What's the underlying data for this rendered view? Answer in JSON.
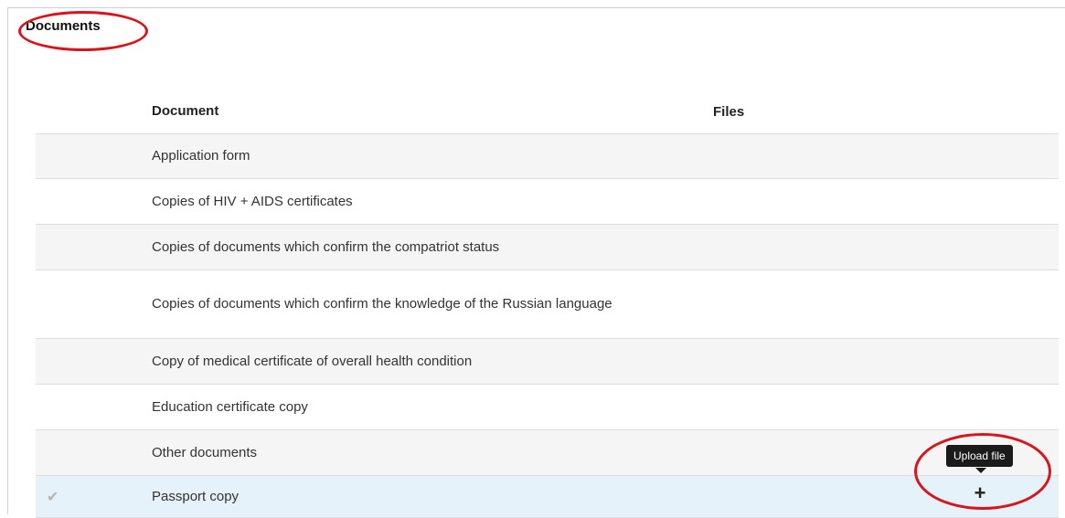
{
  "section": {
    "title": "Documents"
  },
  "table": {
    "headers": {
      "document": "Document",
      "files": "Files"
    },
    "rows": [
      {
        "document": "Application form"
      },
      {
        "document": "Copies of HIV + AIDS certificates"
      },
      {
        "document": "Copies of documents which confirm the compatriot status"
      },
      {
        "document": "Copies of documents which confirm the knowledge of the Russian language"
      },
      {
        "document": "Copy of medical certificate of overall health condition"
      },
      {
        "document": "Education certificate copy"
      },
      {
        "document": "Other documents"
      },
      {
        "document": "Passport copy",
        "checked": true
      }
    ]
  },
  "upload": {
    "tooltip": "Upload file",
    "button_symbol": "+"
  },
  "icons": {
    "row_check": "check-icon",
    "upload": "plus-icon"
  },
  "colors": {
    "annotation": "#d9141c",
    "selected_row": "#e5f2f9",
    "alt_row": "#f5f5f5",
    "tooltip_bg": "#1b1b1b"
  }
}
